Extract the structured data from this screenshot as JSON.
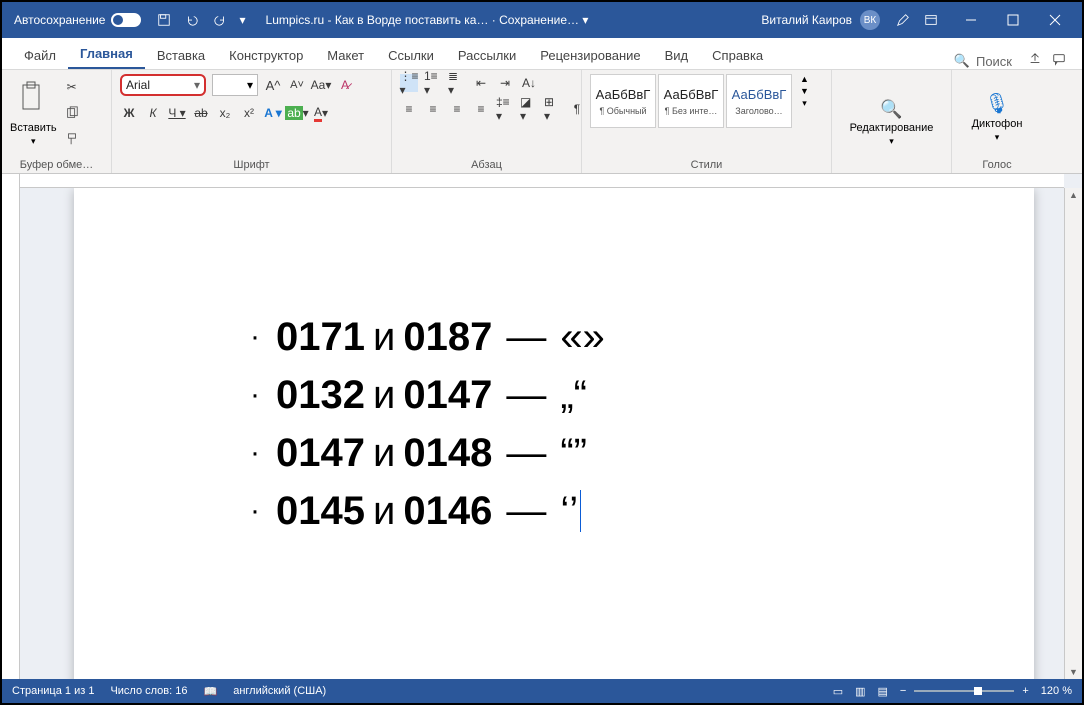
{
  "titlebar": {
    "autosave": "Автосохранение",
    "doc_title": "Lumpics.ru - Как в Ворде поставить ка… · Сохранение… ▾",
    "user": "Виталий Каиров",
    "avatar": "ВК"
  },
  "tabs": {
    "file": "Файл",
    "home": "Главная",
    "insert": "Вставка",
    "design": "Конструктор",
    "layout": "Макет",
    "references": "Ссылки",
    "mailings": "Рассылки",
    "review": "Рецензирование",
    "view": "Вид",
    "help": "Справка",
    "search": "Поиск"
  },
  "ribbon": {
    "clipboard": {
      "label": "Буфер обме…",
      "paste": "Вставить"
    },
    "font": {
      "label": "Шрифт",
      "name": "Arial",
      "size": ""
    },
    "para": {
      "label": "Абзац"
    },
    "styles": {
      "label": "Стили",
      "s1": {
        "samp": "АаБбВвГ",
        "cap": "¶ Обычный"
      },
      "s2": {
        "samp": "АаБбВвГ",
        "cap": "¶ Без инте…"
      },
      "s3": {
        "samp": "АаБбВвГ",
        "cap": "Заголово…"
      }
    },
    "editing": {
      "label": "Редактирование"
    },
    "voice": {
      "label": "Голос",
      "btn": "Диктофон"
    }
  },
  "doc": {
    "items": [
      {
        "a": "0171",
        "b": "0187",
        "q": "«»"
      },
      {
        "a": "0132",
        "b": "0147",
        "q": "„“"
      },
      {
        "a": "0147",
        "b": "0148",
        "q": "“”"
      },
      {
        "a": "0145",
        "b": "0146",
        "q": "‘’"
      }
    ],
    "and": "и",
    "dash": "—"
  },
  "status": {
    "page": "Страница 1 из 1",
    "words": "Число слов: 16",
    "lang": "английский (США)",
    "zoom": "120 %"
  }
}
